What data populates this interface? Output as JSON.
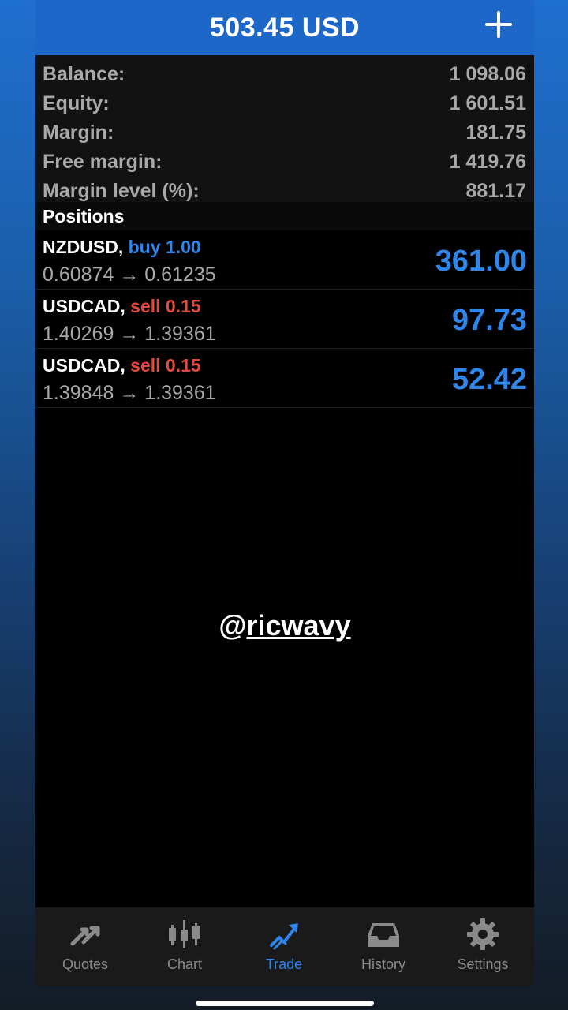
{
  "header": {
    "title": "503.45 USD",
    "add_icon": "plus-icon"
  },
  "summary": [
    {
      "label": "Balance:",
      "value": "1 098.06"
    },
    {
      "label": "Equity:",
      "value": "1 601.51"
    },
    {
      "label": "Margin:",
      "value": "181.75"
    },
    {
      "label": "Free margin:",
      "value": "1 419.76"
    },
    {
      "label": "Margin level (%):",
      "value": "881.17"
    }
  ],
  "positions": {
    "title": "Positions",
    "items": [
      {
        "symbol": "NZDUSD,",
        "side": "buy 1.00",
        "prices": "0.60874 → 0.61235",
        "profit": "361.00"
      },
      {
        "symbol": "USDCAD,",
        "side": "sell 0.15",
        "prices": "1.40269 → 1.39361",
        "profit": "97.73"
      },
      {
        "symbol": "USDCAD,",
        "side": "sell 0.15",
        "prices": "1.39848 → 1.39361",
        "profit": "52.42"
      }
    ]
  },
  "watermark": {
    "at": "@",
    "handle": "ricwavy"
  },
  "tabs": [
    {
      "label": "Quotes",
      "icon": "quotes-arrows-icon"
    },
    {
      "label": "Chart",
      "icon": "candlestick-chart-icon"
    },
    {
      "label": "Trade",
      "icon": "trade-trend-icon",
      "active": true
    },
    {
      "label": "History",
      "icon": "history-inbox-icon"
    },
    {
      "label": "Settings",
      "icon": "settings-gear-icon"
    }
  ],
  "colors": {
    "accent": "#2f86ea",
    "sell": "#e24a3b",
    "header": "#1c67c8"
  }
}
